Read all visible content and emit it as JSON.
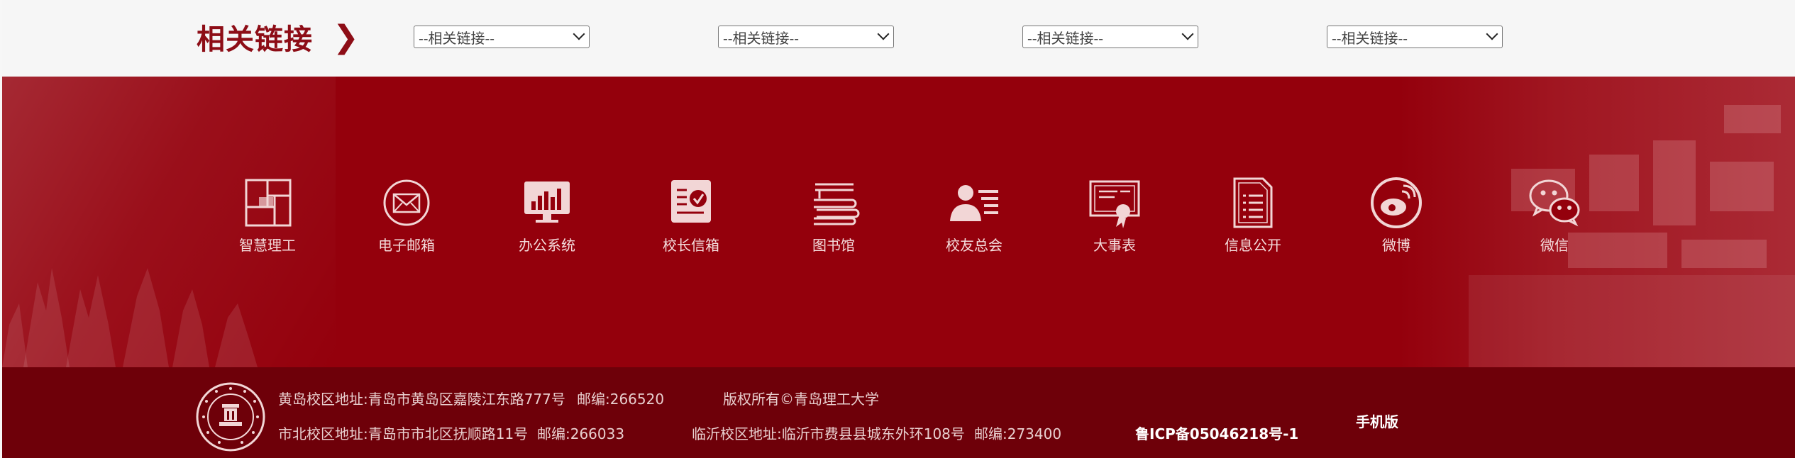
{
  "links": {
    "title": "相关链接",
    "chevron": "❯",
    "selects": [
      "--相关链接--",
      "--相关链接--",
      "--相关链接--",
      "--相关链接--"
    ]
  },
  "nav": [
    {
      "label": "智慧理工",
      "icon": "grid-squares-icon"
    },
    {
      "label": "电子邮箱",
      "icon": "envelope-icon"
    },
    {
      "label": "办公系统",
      "icon": "monitor-chart-icon"
    },
    {
      "label": "校长信箱",
      "icon": "checked-letter-icon"
    },
    {
      "label": "图书馆",
      "icon": "books-icon"
    },
    {
      "label": "校友总会",
      "icon": "person-list-icon"
    },
    {
      "label": "大事表",
      "icon": "certificate-icon"
    },
    {
      "label": "信息公开",
      "icon": "document-icon"
    },
    {
      "label": "微博",
      "icon": "weibo-icon"
    },
    {
      "label": "微信",
      "icon": "wechat-icon"
    }
  ],
  "footer": {
    "huangdao_address": "黄岛校区地址:青岛市黄岛区嘉陵江东路777号",
    "huangdao_postcode": "邮编:266520",
    "copyright": "版权所有©青岛理工大学",
    "shibei_address": "市北校区地址:青岛市市北区抚顺路11号",
    "shibei_postcode": "邮编:266033",
    "linyi_address": "临沂校区地址:临沂市费县县城东外环108号",
    "linyi_postcode": "邮编:273400",
    "icp": "鲁ICP备05046218号-1",
    "mobile": "手机版"
  },
  "colors": {
    "brand_red": "#94000c",
    "footer_red": "#6e0009",
    "title_red": "#8d0d16"
  }
}
